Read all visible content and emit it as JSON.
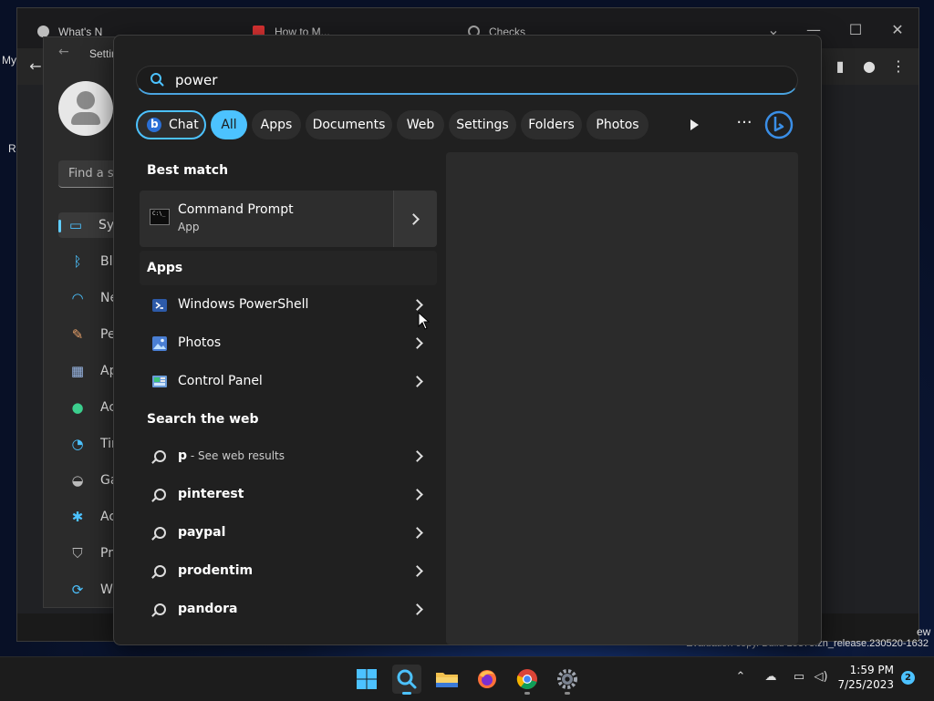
{
  "background_window": {
    "tabs": [
      {
        "title": "What's N"
      },
      {
        "title": "How to M..."
      },
      {
        "title": "Checks"
      }
    ],
    "side_labels": {
      "left_top": "My",
      "left_mid": "R",
      "right_bottom": "ew"
    },
    "eval_text": "Evaluation copy. Build 25375.zn_release.230520-1632"
  },
  "settings": {
    "title": "Settings",
    "search_placeholder": "Find a setting",
    "nav": [
      {
        "label": "System",
        "icon": "monitor-icon"
      },
      {
        "label": "Bluetooth & devices",
        "icon": "bluetooth-icon"
      },
      {
        "label": "Network & internet",
        "icon": "wifi-icon"
      },
      {
        "label": "Personalization",
        "icon": "brush-icon"
      },
      {
        "label": "Apps",
        "icon": "apps-icon"
      },
      {
        "label": "Accounts",
        "icon": "person-icon"
      },
      {
        "label": "Time & language",
        "icon": "clock-globe-icon"
      },
      {
        "label": "Gaming",
        "icon": "gamepad-icon"
      },
      {
        "label": "Accessibility",
        "icon": "accessibility-icon"
      },
      {
        "label": "Privacy & security",
        "icon": "shield-icon"
      },
      {
        "label": "Windows Update",
        "icon": "update-icon"
      }
    ]
  },
  "search": {
    "query": "power",
    "filters": [
      {
        "label": "Chat"
      },
      {
        "label": "All"
      },
      {
        "label": "Apps"
      },
      {
        "label": "Documents"
      },
      {
        "label": "Web"
      },
      {
        "label": "Settings"
      },
      {
        "label": "Folders"
      },
      {
        "label": "Photos"
      }
    ],
    "active_filter": "All",
    "more_label": "···",
    "best_match": {
      "section_label": "Best match",
      "title": "Command Prompt",
      "subtitle": "App"
    },
    "apps": {
      "section_label": "Apps",
      "items": [
        {
          "label": "Windows PowerShell",
          "icon": "powershell-icon"
        },
        {
          "label": "Photos",
          "icon": "photos-icon"
        },
        {
          "label": "Control Panel",
          "icon": "control-panel-icon"
        }
      ]
    },
    "web": {
      "section_label": "Search the web",
      "items": [
        {
          "label": "p",
          "sub": " - See web results"
        },
        {
          "label": "pinterest",
          "sub": ""
        },
        {
          "label": "paypal",
          "sub": ""
        },
        {
          "label": "prodentim",
          "sub": ""
        },
        {
          "label": "pandora",
          "sub": ""
        }
      ]
    }
  },
  "taskbar": {
    "apps": [
      {
        "name": "start",
        "icon": "windows-logo-icon"
      },
      {
        "name": "search",
        "icon": "search-icon",
        "active": true
      },
      {
        "name": "file-explorer",
        "icon": "folder-icon"
      },
      {
        "name": "firefox",
        "icon": "firefox-icon"
      },
      {
        "name": "chrome",
        "icon": "chrome-icon"
      },
      {
        "name": "settings",
        "icon": "gear-icon"
      }
    ],
    "time": "1:59 PM",
    "date": "7/25/2023",
    "notification_count": "2"
  },
  "colors": {
    "accent": "#4cc2ff",
    "panel_bg": "#202020",
    "card_bg": "#2d2d2d"
  }
}
